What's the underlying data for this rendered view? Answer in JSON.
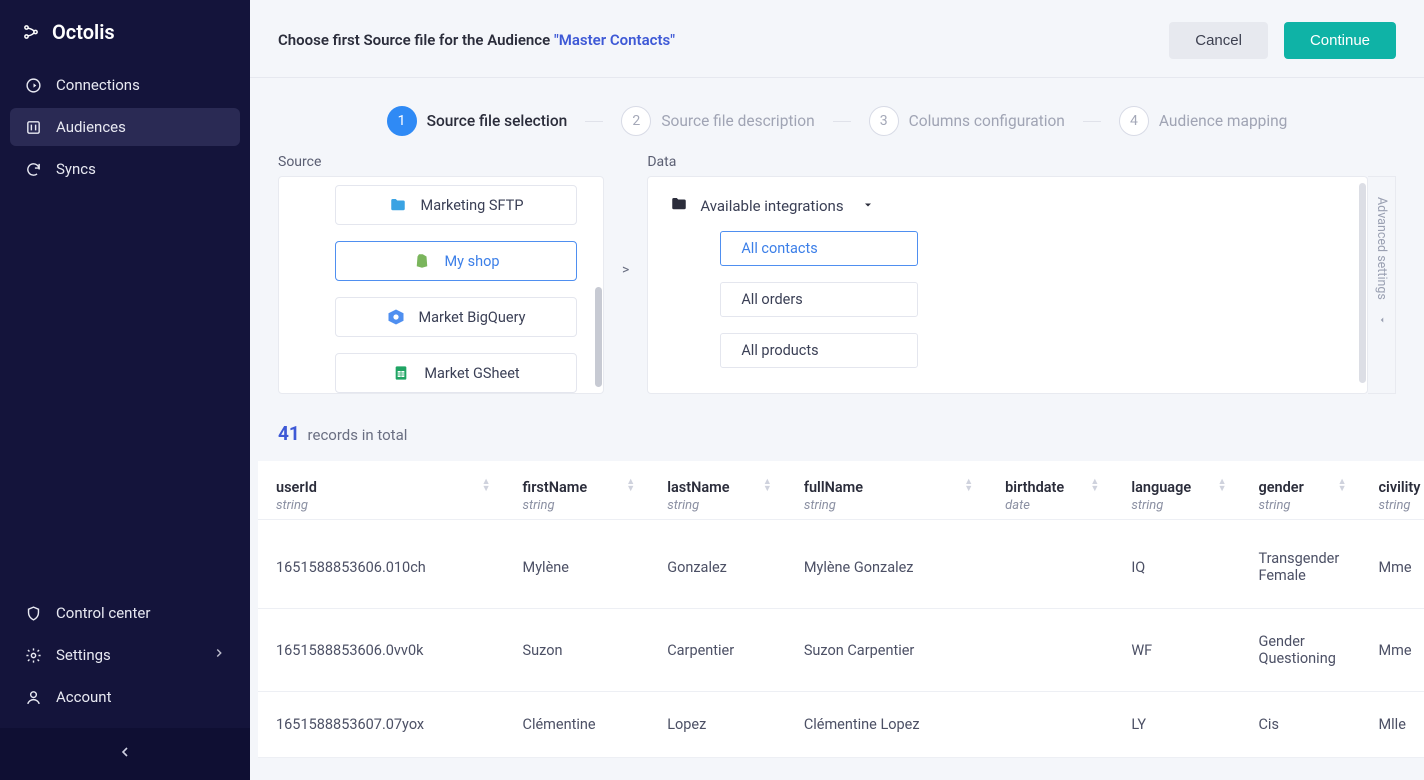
{
  "brand": "Octolis",
  "sidebar": {
    "nav": [
      {
        "label": "Connections"
      },
      {
        "label": "Audiences"
      },
      {
        "label": "Syncs"
      }
    ],
    "bottom": [
      {
        "label": "Control center"
      },
      {
        "label": "Settings"
      },
      {
        "label": "Account"
      }
    ]
  },
  "header": {
    "prefix": "Choose first Source file for the Audience ",
    "audience": "\"Master Contacts\"",
    "cancel": "Cancel",
    "continue": "Continue"
  },
  "stepper": [
    {
      "n": "1",
      "label": "Source file selection"
    },
    {
      "n": "2",
      "label": "Source file description"
    },
    {
      "n": "3",
      "label": "Columns configuration"
    },
    {
      "n": "4",
      "label": "Audience mapping"
    }
  ],
  "panels": {
    "source_label": "Source",
    "data_label": "Data",
    "sources": [
      {
        "label": "Marketing SFTP"
      },
      {
        "label": "My shop"
      },
      {
        "label": "Market BigQuery"
      },
      {
        "label": "Market GSheet"
      }
    ],
    "data_group": "Available integrations",
    "data_items": [
      {
        "label": "All contacts"
      },
      {
        "label": "All orders"
      },
      {
        "label": "All products"
      }
    ],
    "advanced": "Advanced settings"
  },
  "records": {
    "count": "41",
    "suffix": "records in total",
    "columns": [
      {
        "name": "userId",
        "type": "string"
      },
      {
        "name": "firstName",
        "type": "string"
      },
      {
        "name": "lastName",
        "type": "string"
      },
      {
        "name": "fullName",
        "type": "string"
      },
      {
        "name": "birthdate",
        "type": "date"
      },
      {
        "name": "language",
        "type": "string"
      },
      {
        "name": "gender",
        "type": "string"
      },
      {
        "name": "civility",
        "type": "string"
      }
    ],
    "rows": [
      {
        "userId": "1651588853606.010ch",
        "firstName": "Mylène",
        "lastName": "Gonzalez",
        "fullName": "Mylène Gonzalez",
        "birthdate": "",
        "language": "IQ",
        "gender": "Transgender Female",
        "civility": "Mme"
      },
      {
        "userId": "1651588853606.0vv0k",
        "firstName": "Suzon",
        "lastName": "Carpentier",
        "fullName": "Suzon Carpentier",
        "birthdate": "",
        "language": "WF",
        "gender": "Gender Questioning",
        "civility": "Mme"
      },
      {
        "userId": "1651588853607.07yox",
        "firstName": "Clémentine",
        "lastName": "Lopez",
        "fullName": "Clémentine Lopez",
        "birthdate": "",
        "language": "LY",
        "gender": "Cis",
        "civility": "Mlle"
      }
    ]
  }
}
